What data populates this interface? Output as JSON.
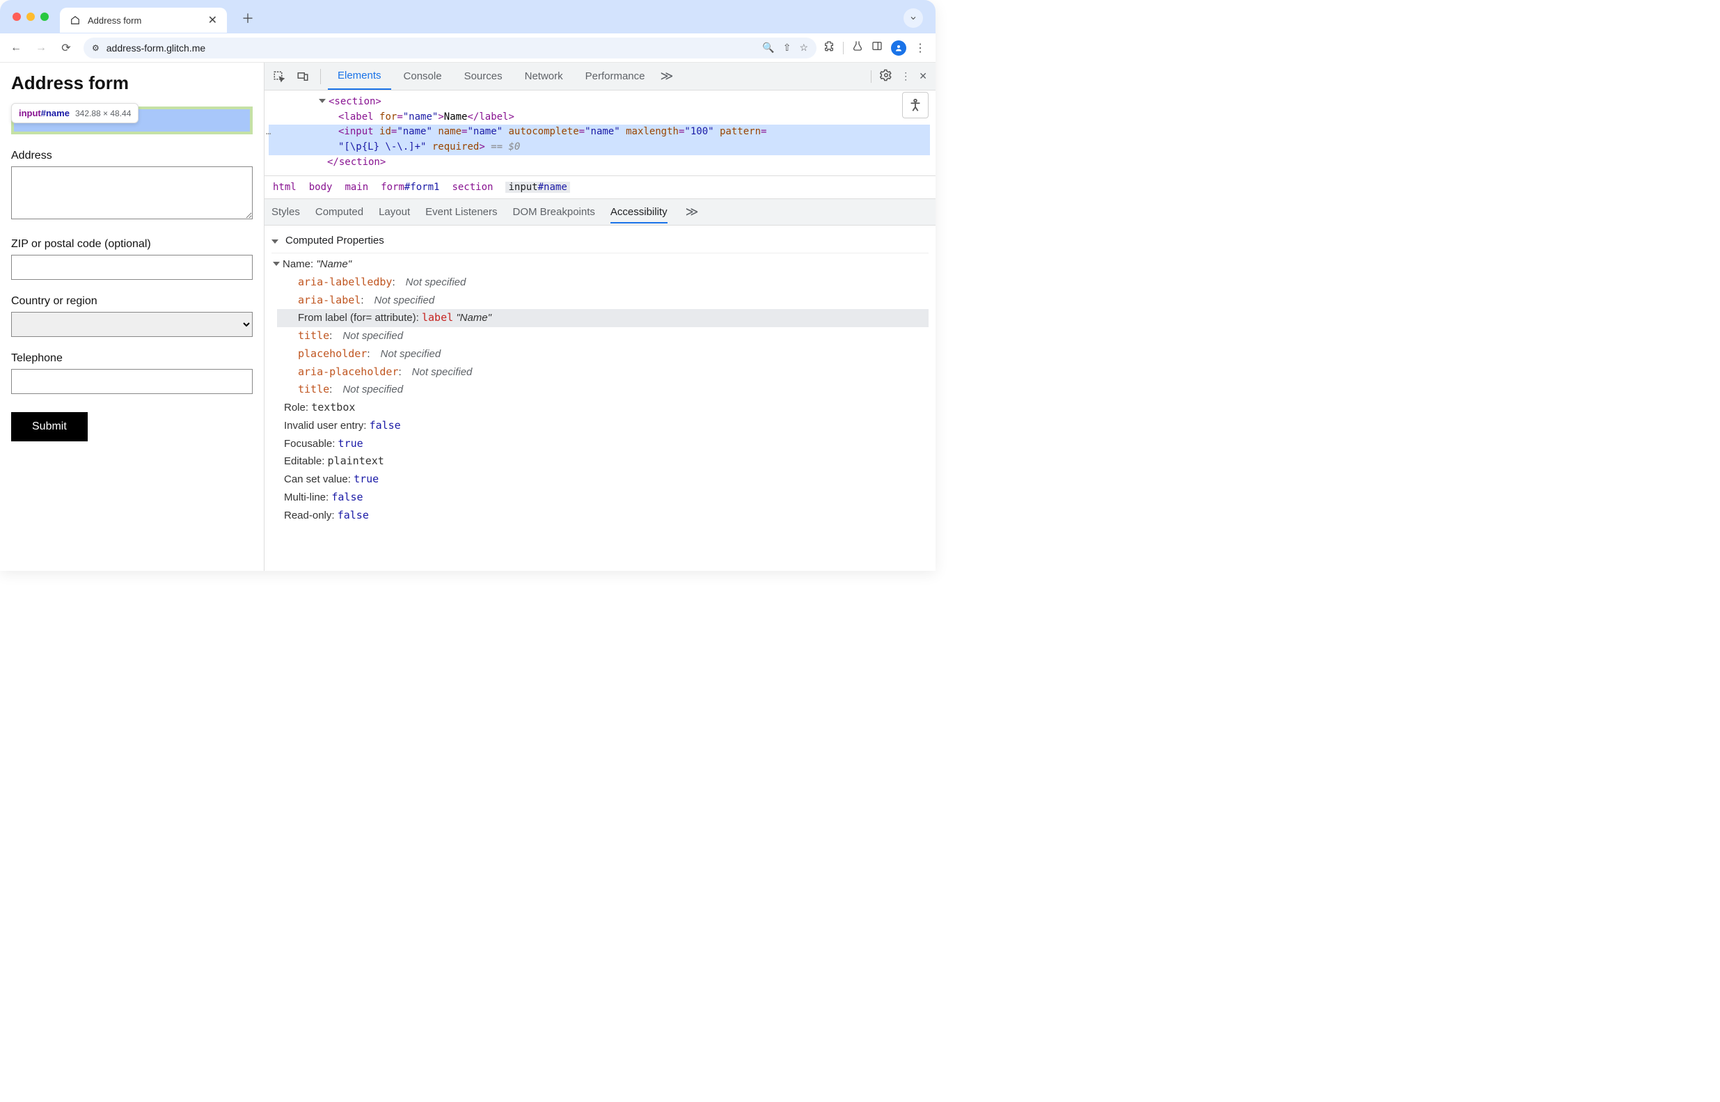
{
  "browser": {
    "tab_title": "Address form",
    "url": "address-form.glitch.me",
    "traffic_colors": [
      "#ff5f57",
      "#febc2e",
      "#28c840"
    ]
  },
  "inspector_tooltip": {
    "tag": "input",
    "id": "#name",
    "dims": "342.88 × 48.44"
  },
  "page": {
    "title": "Address form",
    "labels": {
      "address": "Address",
      "zip": "ZIP or postal code (optional)",
      "country": "Country or region",
      "telephone": "Telephone"
    },
    "submit": "Submit"
  },
  "devtools": {
    "tabs": [
      "Elements",
      "Console",
      "Sources",
      "Network",
      "Performance"
    ],
    "active_tab": "Elements",
    "dom": {
      "section_open": "<section>",
      "label_open": "<label ",
      "label_for_attr": "for",
      "label_for_val": "\"name\"",
      "label_text": "Name",
      "label_close": "</label>",
      "input_tag": "<input ",
      "input_attrs": [
        {
          "k": "id",
          "v": "\"name\""
        },
        {
          "k": "name",
          "v": "\"name\""
        },
        {
          "k": "autocomplete",
          "v": "\"name\""
        },
        {
          "k": "maxlength",
          "v": "\"100\""
        }
      ],
      "input_pattern_k": "pattern",
      "input_pattern_v": "\"[\\p{L} \\-\\.]+\"",
      "input_required": "required",
      "input_eq": " == ",
      "input_dim": "$0",
      "section_close": "</section>"
    },
    "breadcrumb": [
      "html",
      "body",
      "main",
      "form#form1",
      "section",
      "input#name"
    ],
    "breadcrumb_selected": "input#name",
    "subtabs": [
      "Styles",
      "Computed",
      "Layout",
      "Event Listeners",
      "DOM Breakpoints",
      "Accessibility"
    ],
    "subtab_active": "Accessibility",
    "acc": {
      "header": "Computed Properties",
      "name_label": "Name: ",
      "name_value": "\"Name\"",
      "props": [
        {
          "key": "aria-labelledby",
          "val": "Not specified",
          "type": "ns"
        },
        {
          "key": "aria-label",
          "val": "Not specified",
          "type": "ns"
        }
      ],
      "from_label_prefix": "From label (for= attribute): ",
      "from_label_tag": "label",
      "from_label_val": "\"Name\"",
      "props2": [
        {
          "key": "title",
          "val": "Not specified",
          "type": "ns"
        },
        {
          "key": "placeholder",
          "val": "Not specified",
          "type": "ns"
        },
        {
          "key": "aria-placeholder",
          "val": "Not specified",
          "type": "ns"
        },
        {
          "key": "title",
          "val": "Not specified",
          "type": "ns"
        }
      ],
      "roles": [
        {
          "k": "Role",
          "v": "textbox",
          "t": "role"
        },
        {
          "k": "Invalid user entry",
          "v": "false",
          "t": "bool"
        },
        {
          "k": "Focusable",
          "v": "true",
          "t": "bool"
        },
        {
          "k": "Editable",
          "v": "plaintext",
          "t": "role"
        },
        {
          "k": "Can set value",
          "v": "true",
          "t": "bool"
        },
        {
          "k": "Multi-line",
          "v": "false",
          "t": "bool"
        },
        {
          "k": "Read-only",
          "v": "false",
          "t": "bool"
        }
      ]
    }
  }
}
